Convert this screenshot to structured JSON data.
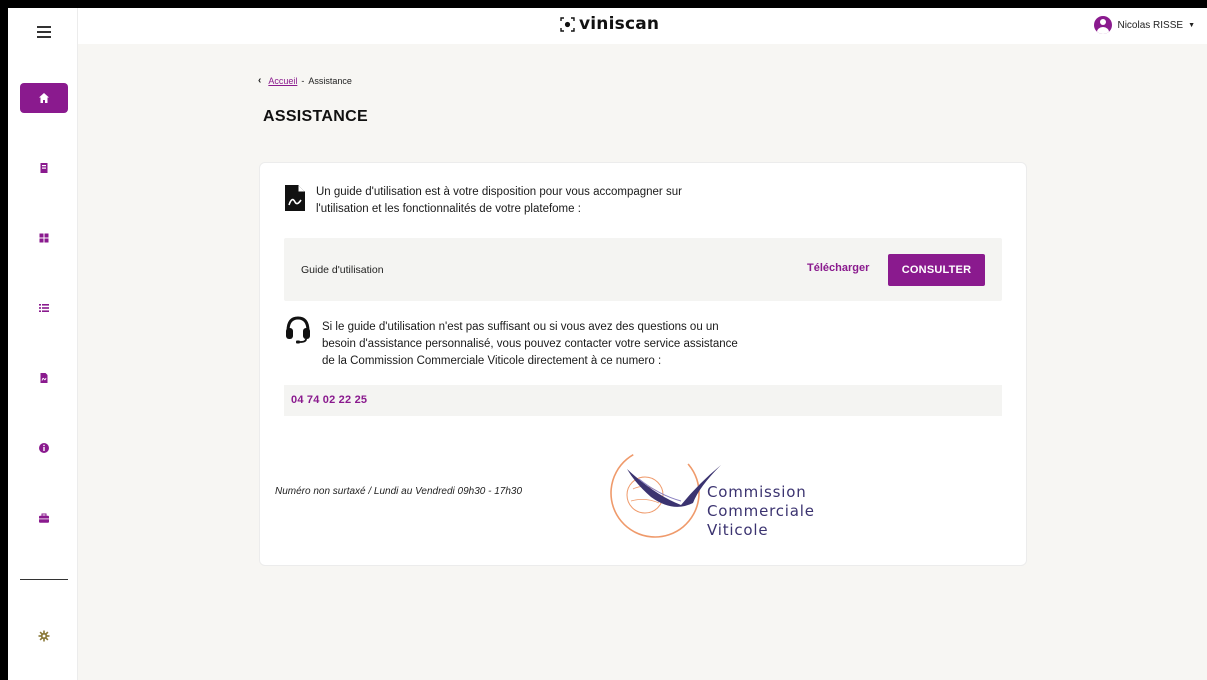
{
  "app": {
    "brand": "viniscan",
    "user_name": "Nicolas RISSE",
    "colors": {
      "accent": "#8a1a8e",
      "logo_navy": "#3b3370",
      "logo_orange": "#ef9a6b"
    }
  },
  "sidebar": {
    "menu_icon": "hamburger-icon",
    "items": [
      {
        "icon": "home-icon",
        "active": true
      },
      {
        "icon": "bookmark-icon",
        "active": false
      },
      {
        "icon": "grid-icon",
        "active": false
      },
      {
        "icon": "list-icon",
        "active": false
      },
      {
        "icon": "pdf-file-icon",
        "active": false
      },
      {
        "icon": "info-icon",
        "active": false
      },
      {
        "icon": "briefcase-icon",
        "active": false
      }
    ],
    "bottom_icon": "gear-icon"
  },
  "breadcrumb": {
    "home": "Accueil",
    "separator": "-",
    "current": "Assistance"
  },
  "page": {
    "title": "ASSISTANCE",
    "intro_line1": "Un guide d'utilisation est à votre disposition pour vous accompagner sur",
    "intro_line2": "l'utilisation et les fonctionnalités de votre platefome :",
    "guide_label": "Guide d'utilisation",
    "download_label": "Télécharger",
    "consult_label": "CONSULTER",
    "help_line1": "Si le guide d'utilisation n'est pas suffisant ou si vous avez des questions ou un",
    "help_line2": "besoin d'assistance personnalisé, vous pouvez contacter votre service assistance",
    "help_line3": "de la Commission Commerciale Viticole directement à ce numero :",
    "phone": "04 74 02 22 25",
    "hours": "Numéro non surtaxé / Lundi au Vendredi 09h30 - 17h30"
  },
  "logo": {
    "line1": "Commission",
    "line2": "Commerciale",
    "line3": "Viticole"
  }
}
